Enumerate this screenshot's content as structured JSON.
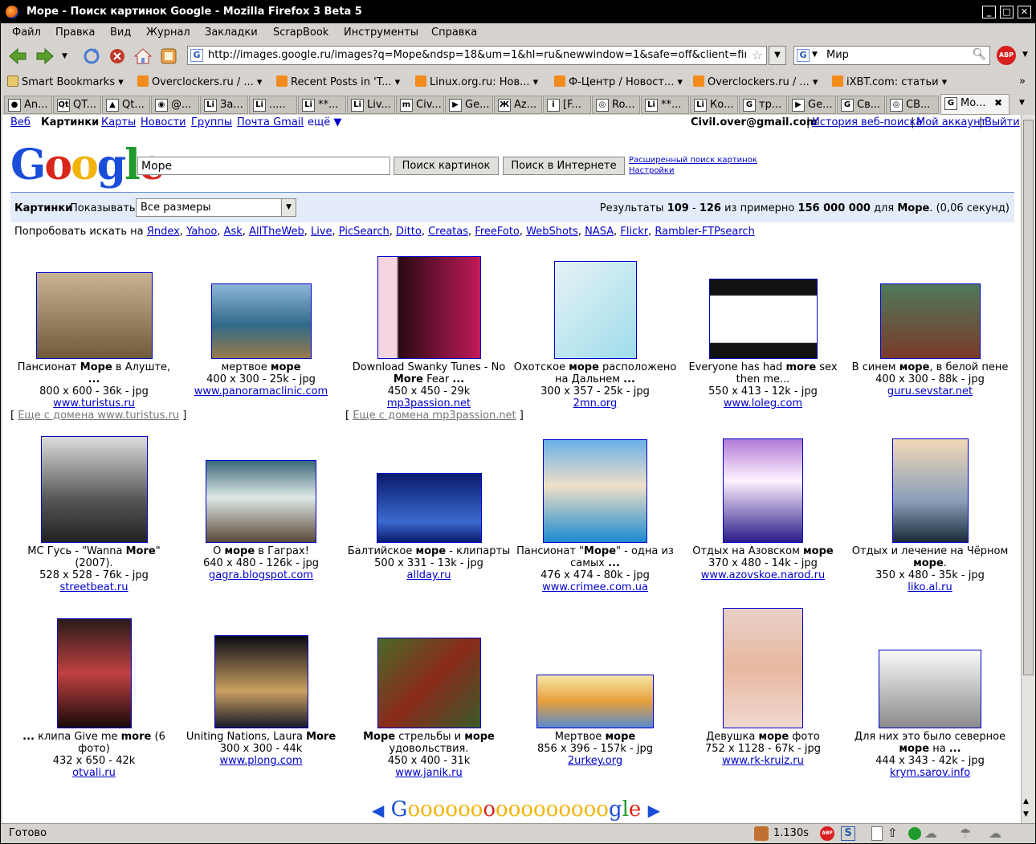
{
  "window": {
    "title": "Море - Поиск картинок Google - Mozilla Firefox 3 Beta 5"
  },
  "menu": [
    "Файл",
    "Правка",
    "Вид",
    "Журнал",
    "Закладки",
    "ScrapBook",
    "Инструменты",
    "Справка"
  ],
  "nav": {
    "url": "http://images.google.ru/images?q=Море&ndsp=18&um=1&hl=ru&newwindow=1&safe=off&client=firef",
    "search_engine": "G",
    "search_value": "Мир",
    "abp": "ABP"
  },
  "bookmarks": [
    "Smart Bookmarks",
    "Overclockers.ru / ...",
    "Recent Posts in 'T...",
    "Linux.org.ru: Нов...",
    "Ф-Центр / Новост...",
    "Overclockers.ru / ...",
    "iXBT.com: статьи"
  ],
  "tabs": [
    {
      "icon": "●",
      "label": "An..."
    },
    {
      "icon": "Qt",
      "label": "QT..."
    },
    {
      "icon": "▲",
      "label": "Qt..."
    },
    {
      "icon": "◉",
      "label": "@..."
    },
    {
      "icon": "Li",
      "label": "За..."
    },
    {
      "icon": "Li",
      "label": "....."
    },
    {
      "icon": "Li",
      "label": "**..."
    },
    {
      "icon": "Li",
      "label": "Liv..."
    },
    {
      "icon": "m",
      "label": "Civ..."
    },
    {
      "icon": "▶",
      "label": "Ge..."
    },
    {
      "icon": "Ж",
      "label": "Az..."
    },
    {
      "icon": "i",
      "label": "[F..."
    },
    {
      "icon": "◎",
      "label": "Ro..."
    },
    {
      "icon": "Li",
      "label": "**..."
    },
    {
      "icon": "Li",
      "label": "Ко..."
    },
    {
      "icon": "G",
      "label": "тр..."
    },
    {
      "icon": "▶",
      "label": "Ge..."
    },
    {
      "icon": "G",
      "label": "Св..."
    },
    {
      "icon": "◎",
      "label": "СВ..."
    },
    {
      "icon": "G",
      "label": "Мо..."
    }
  ],
  "gbar": {
    "links": [
      "Веб",
      "Картинки",
      "Карты",
      "Новости",
      "Группы",
      "Почта Gmail",
      "ещё ▼"
    ],
    "user": "Civil.over@gmail.com",
    "history": "История веб-поиска",
    "account": "Мой аккаунт",
    "logout": "Выйти",
    "sep": "|"
  },
  "search": {
    "logo": "Google",
    "query": "Море",
    "btn_images": "Поиск картинок",
    "btn_web": "Поиск в Интернете",
    "adv": "Расширенный поиск картинок",
    "settings": "Настройки"
  },
  "bar": {
    "title": "Картинки",
    "show": "Показывать:",
    "size": "Все размеры",
    "res_prefix": "Результаты",
    "res_from": "109",
    "res_dash": "-",
    "res_to": "126",
    "res_mid": "из примерно",
    "res_total": "156 000 000",
    "res_for": "для",
    "res_q": "Море",
    "res_time": ". (0,06 секунд)"
  },
  "try": {
    "prefix": "Попробовать искать на",
    "engines": [
      "Яndex",
      "Yahoo",
      "Ask",
      "AllTheWeb",
      "Live",
      "PicSearch",
      "Ditto",
      "Creatas",
      "FreeFoto",
      "WebShots",
      "NASA",
      "Flickr",
      "Rambler-FTPsearch"
    ]
  },
  "images": [
    {
      "cap": "Пансионат <b>Море</b> в Алуште, <b>...</b>",
      "meta": "800 x 600 - 36k - jpg",
      "src": "www.turistus.ru",
      "more": "Еще с домена www.turistus.ru"
    },
    {
      "cap": "мертвое <b>море</b>",
      "meta": "400 x 300 - 25k - jpg",
      "src": "www.panoramaclinic.com"
    },
    {
      "cap": "Download Swanky Tunes - No <b>More</b> Fear <b>...</b>",
      "meta": "450 x 450 - 29k",
      "src": "mp3passion.net",
      "more": "Еще с домена mp3passion.net"
    },
    {
      "cap": "Охотское <b>море</b> расположено на Дальнем <b>...</b>",
      "meta": "300 x 357 - 25k - jpg",
      "src": "2mn.org"
    },
    {
      "cap": "Everyone has had <b>more</b> sex then me...",
      "meta": "550 x 413 - 12k - jpg",
      "src": "www.loleg.com"
    },
    {
      "cap": "В синем <b>море</b>, в белой пене",
      "meta": "400 x 300 - 88k - jpg",
      "src": "guru.sevstar.net"
    },
    {
      "cap": "MC Гусь - \"Wanna <b>More</b>\" (2007).",
      "meta": "528 x 528 - 76k - jpg",
      "src": "streetbeat.ru"
    },
    {
      "cap": "О <b>море</b> в Гаграх!",
      "meta": "640 x 480 - 126k - jpg",
      "src": "gagra.blogspot.com"
    },
    {
      "cap": "Балтийское <b>море</b> - клипарты",
      "meta": "500 x 331 - 13k - jpg",
      "src": "allday.ru"
    },
    {
      "cap": "Пансионат \"<b>Море</b>\" - одна из самых <b>...</b>",
      "meta": "476 x 474 - 80k - jpg",
      "src": "www.crimee.com.ua"
    },
    {
      "cap": "Отдых на Азовском <b>море</b>",
      "meta": "370 x 480 - 14k - jpg",
      "src": "www.azovskoe.narod.ru"
    },
    {
      "cap": "Отдых и лечение на Чёрном <b>море</b>.",
      "meta": "350 x 480 - 35k - jpg",
      "src": "liko.al.ru"
    },
    {
      "cap": "<b>...</b> клипа Give me <b>more</b> (6 фото)",
      "meta": "432 x 650 - 42k",
      "src": "otvali.ru"
    },
    {
      "cap": "Uniting Nations, Laura <b>More</b>",
      "meta": "300 x 300 - 44k",
      "src": "www.plong.com"
    },
    {
      "cap": "<b>Море</b> стрельбы и <b>море</b> удовольствия.",
      "meta": "450 x 400 - 31k",
      "src": "www.janik.ru"
    },
    {
      "cap": "Мертвое <b>море</b>",
      "meta": "856 x 396 - 157k - jpg",
      "src": "2urkey.org"
    },
    {
      "cap": "Девушка <b>море</b> фото",
      "meta": "752 x 1128 - 67k - jpg",
      "src": "www.rk-kruiz.ru"
    },
    {
      "cap": "Для них это было северное <b>море</b> на <b>...</b>",
      "meta": "444 x 343 - 42k - jpg",
      "src": "krym.sarov.info"
    }
  ],
  "pager": {
    "prev": "◀",
    "next": "▶",
    "word": "Goooooooooooooooogle"
  },
  "status": {
    "text": "Готово",
    "time": "1.130s"
  },
  "colors": {
    "link": "#0000cc",
    "bar_bg": "#e5ecf9",
    "bar_border": "#6b90da"
  }
}
